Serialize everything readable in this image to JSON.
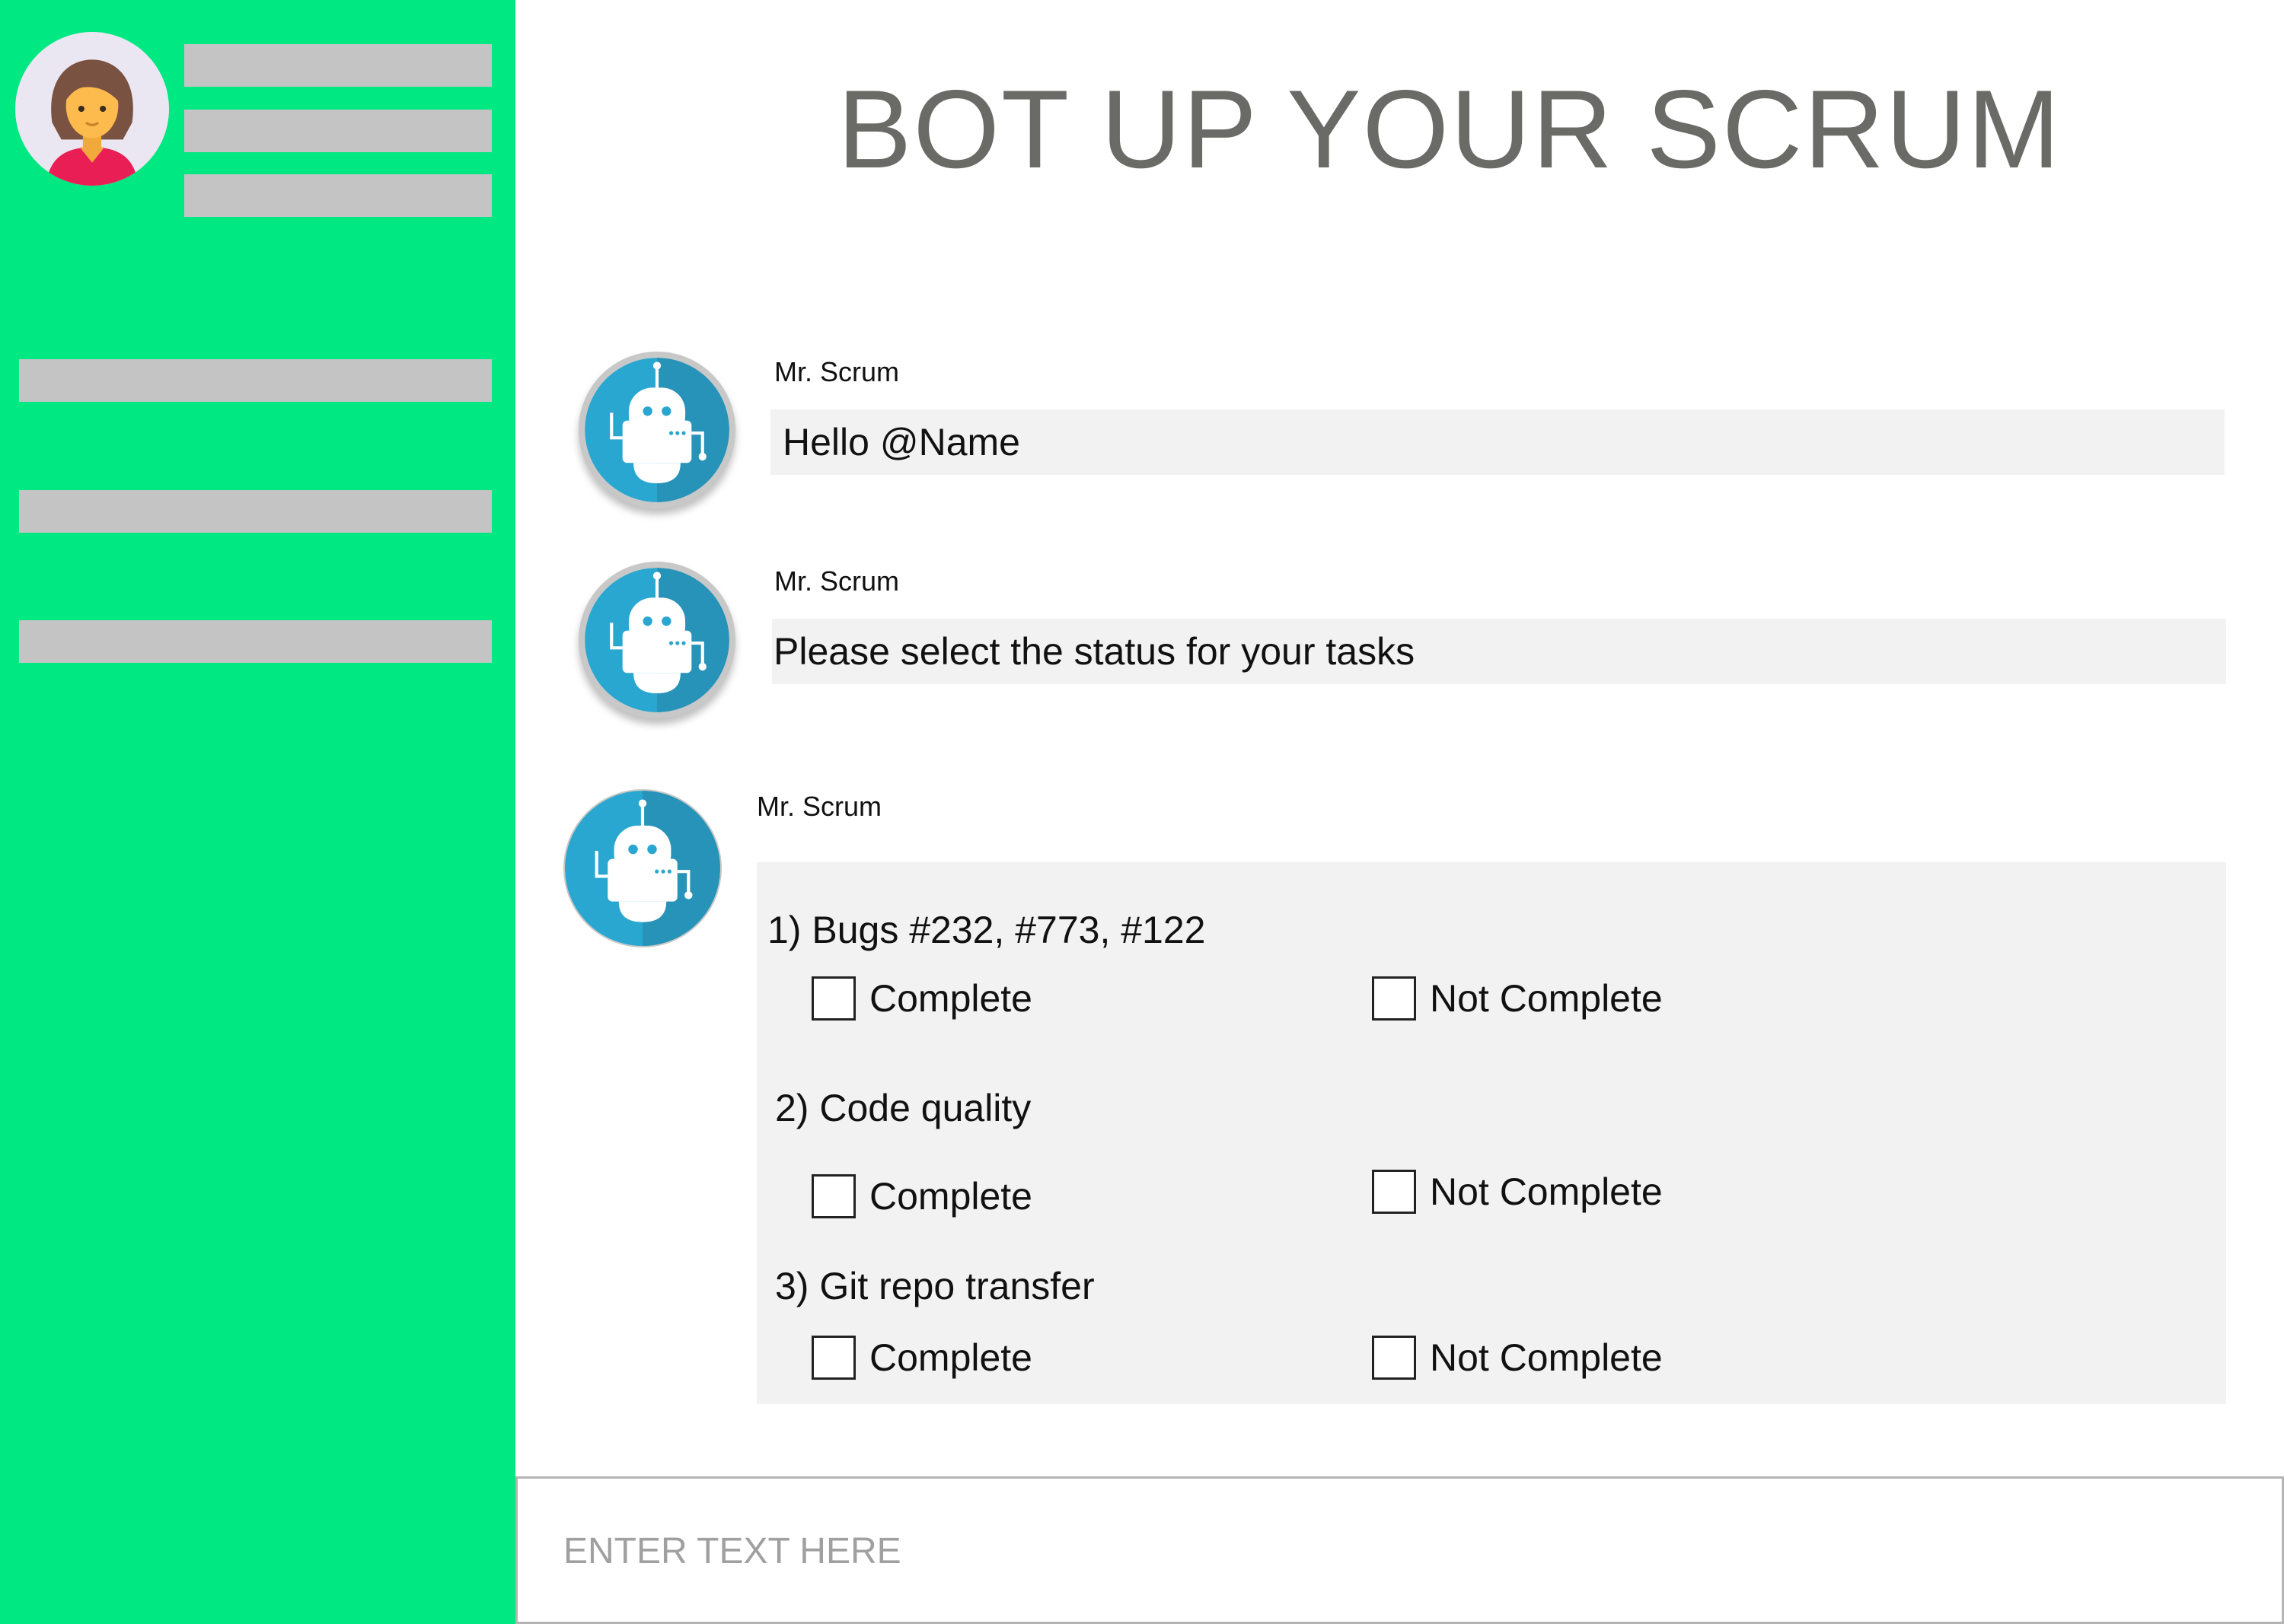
{
  "header": {
    "title": "BOT UP YOUR SCRUM"
  },
  "colors": {
    "sidebar": "#00E882",
    "bot_avatar": "#29A7D1",
    "bubble": "#F2F2F2",
    "title": "#6A6A66"
  },
  "sidebar": {
    "avatar_icon": "woman-avatar-icon"
  },
  "messages": [
    {
      "sender": "Mr. Scrum",
      "text": "Hello @Name",
      "avatar_icon": "robot-icon"
    },
    {
      "sender": "Mr. Scrum",
      "text": "Please select the status for your tasks",
      "avatar_icon": "robot-icon"
    },
    {
      "sender": "Mr. Scrum",
      "avatar_icon": "robot-icon"
    }
  ],
  "tasks": [
    {
      "title": "1) Bugs #232, #773, #122",
      "options": [
        "Complete",
        "Not Complete"
      ]
    },
    {
      "title": "2) Code quality",
      "options": [
        "Complete",
        "Not Complete"
      ]
    },
    {
      "title": "3) Git repo transfer",
      "options": [
        "Complete",
        "Not Complete"
      ]
    }
  ],
  "composer": {
    "placeholder": "ENTER TEXT HERE"
  }
}
